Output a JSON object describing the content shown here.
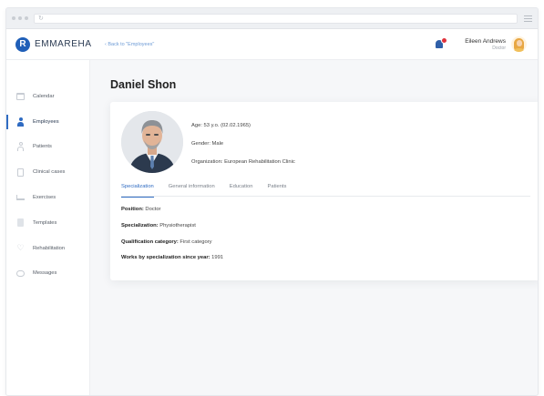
{
  "app": {
    "name": "EMMAREHA",
    "logo_letter": "R"
  },
  "nav": {
    "back_link": "‹ Back to \"Employees\""
  },
  "user": {
    "name": "Eileen Andrews",
    "role": "Doctor"
  },
  "sidebar": {
    "items": [
      {
        "label": "Calendar",
        "icon": "calendar-icon"
      },
      {
        "label": "Employees",
        "icon": "employees-icon",
        "active": true
      },
      {
        "label": "Patients",
        "icon": "patients-icon"
      },
      {
        "label": "Clinical cases",
        "icon": "clipboard-icon"
      },
      {
        "label": "Exercises",
        "icon": "exercises-icon"
      },
      {
        "label": "Templates",
        "icon": "templates-icon"
      },
      {
        "label": "Rehabilitation",
        "icon": "heart-icon"
      },
      {
        "label": "Messages",
        "icon": "messages-icon"
      }
    ]
  },
  "profile": {
    "name": "Daniel Shon",
    "age": "Age: 53 y.o. (02.02.1965)",
    "gender": "Gender: Male",
    "organization": "Organization: European Rehabilitation Clinic"
  },
  "tabs": [
    "Specialization",
    "General information",
    "Education",
    "Patients"
  ],
  "details": [
    {
      "label": "Position:",
      "value": " Doctor"
    },
    {
      "label": "Specialization:",
      "value": " Physiotherapist"
    },
    {
      "label": "Qualification category:",
      "value": " First category"
    },
    {
      "label": "Works by specialization since year:",
      "value": " 1991"
    }
  ],
  "colors": {
    "accent": "#2f6bc2",
    "brand": "#1f5fb8",
    "notification": "#e0323c"
  }
}
